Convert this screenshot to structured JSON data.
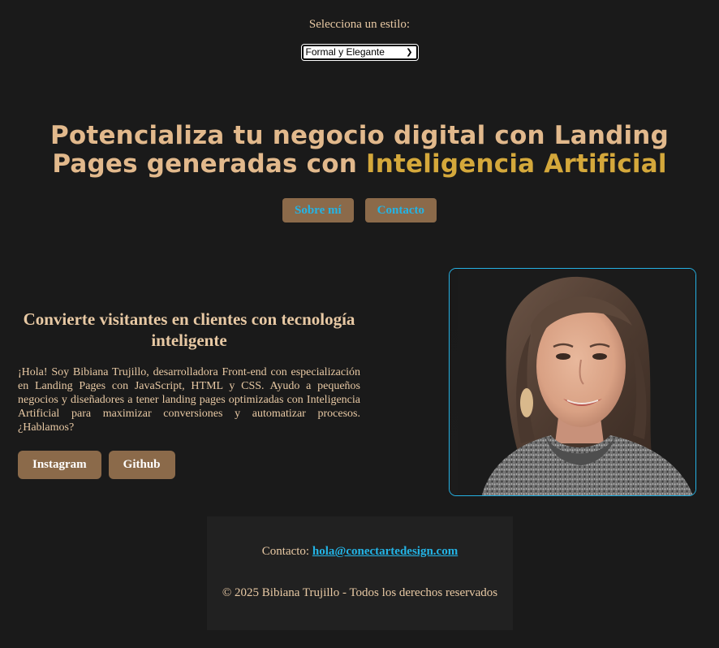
{
  "style_picker": {
    "label": "Selecciona un estilo:",
    "selected": "Formal y Elegante"
  },
  "hero": {
    "title_main": "Potencializa tu negocio digital con Landing Pages generadas con ",
    "title_accent": "Inteligencia Artificial"
  },
  "nav": {
    "about_label": "Sobre mí",
    "contact_label": "Contacto"
  },
  "about": {
    "heading": "Convierte visitantes en clientes con tecnología inteligente",
    "body": "¡Hola! Soy Bibiana Trujillo, desarrolladora Front-end con especialización en Landing Pages con JavaScript, HTML y CSS. Ayudo a pequeños negocios y diseñadores a tener landing pages optimizadas con Inteligencia Artificial para maximizar conversiones y automatizar procesos. ¿Hablamos?",
    "instagram_label": "Instagram",
    "github_label": "Github"
  },
  "footer": {
    "contact_prefix": "Contacto:",
    "email": "hola@conectartedesign.com",
    "copyright": "© 2025 Bibiana Trujillo - Todos los derechos reservados"
  },
  "colors": {
    "background": "#1a1a1a",
    "text": "#e8c9a4",
    "accent_gold": "#d4a83b",
    "button_brown": "#8b6a4a",
    "link_blue": "#23b4e6"
  }
}
